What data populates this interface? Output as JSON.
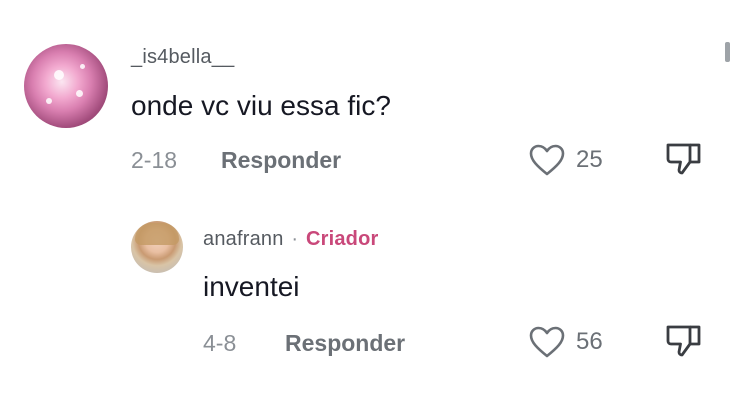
{
  "comments": [
    {
      "username": "_is4bella__",
      "text": "onde vc viu essa fic?",
      "date": "2-18",
      "reply_label": "Responder",
      "likes": "25",
      "avatar_icon": "pink-glitter-avatar"
    },
    {
      "username": "anafrann",
      "separator": "·",
      "badge": "Criador",
      "text": "inventei",
      "date": "4-8",
      "reply_label": "Responder",
      "likes": "56",
      "avatar_icon": "profile-photo-avatar"
    }
  ],
  "colors": {
    "creator_badge": "#c9487a",
    "text_primary": "#161823",
    "text_secondary": "#8a8f95"
  }
}
